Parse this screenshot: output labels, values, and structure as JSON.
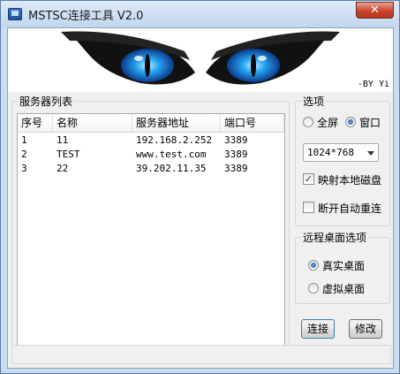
{
  "window": {
    "title": "MSTSC连接工具 V2.0"
  },
  "banner": {
    "by_label": "-BY Yi"
  },
  "server_list": {
    "legend": "服务器列表",
    "columns": [
      "序号",
      "名称",
      "服务器地址",
      "端口号"
    ],
    "rows": [
      [
        "1",
        "11",
        "192.168.2.252",
        "3389"
      ],
      [
        "2",
        "TEST",
        "www.test.com",
        "3389"
      ],
      [
        "3",
        "22",
        "39.202.11.35",
        "3389"
      ]
    ]
  },
  "options": {
    "legend": "选项",
    "fullscreen_label": "全屏",
    "window_label": "窗口",
    "display_mode": "窗口",
    "resolution": "1024*768",
    "map_local_disk_label": "映射本地磁盘",
    "map_local_disk": true,
    "auto_reconnect_label": "断开自动重连",
    "auto_reconnect": false
  },
  "remote_desktop": {
    "legend": "远程桌面选项",
    "real_label": "真实桌面",
    "virtual_label": "虚拟桌面",
    "selected": "真实桌面"
  },
  "buttons": {
    "connect": "连接",
    "modify": "修改"
  },
  "colors": {
    "eye_iris": "#29a9f5",
    "title_bar": "#c9dcf0"
  }
}
